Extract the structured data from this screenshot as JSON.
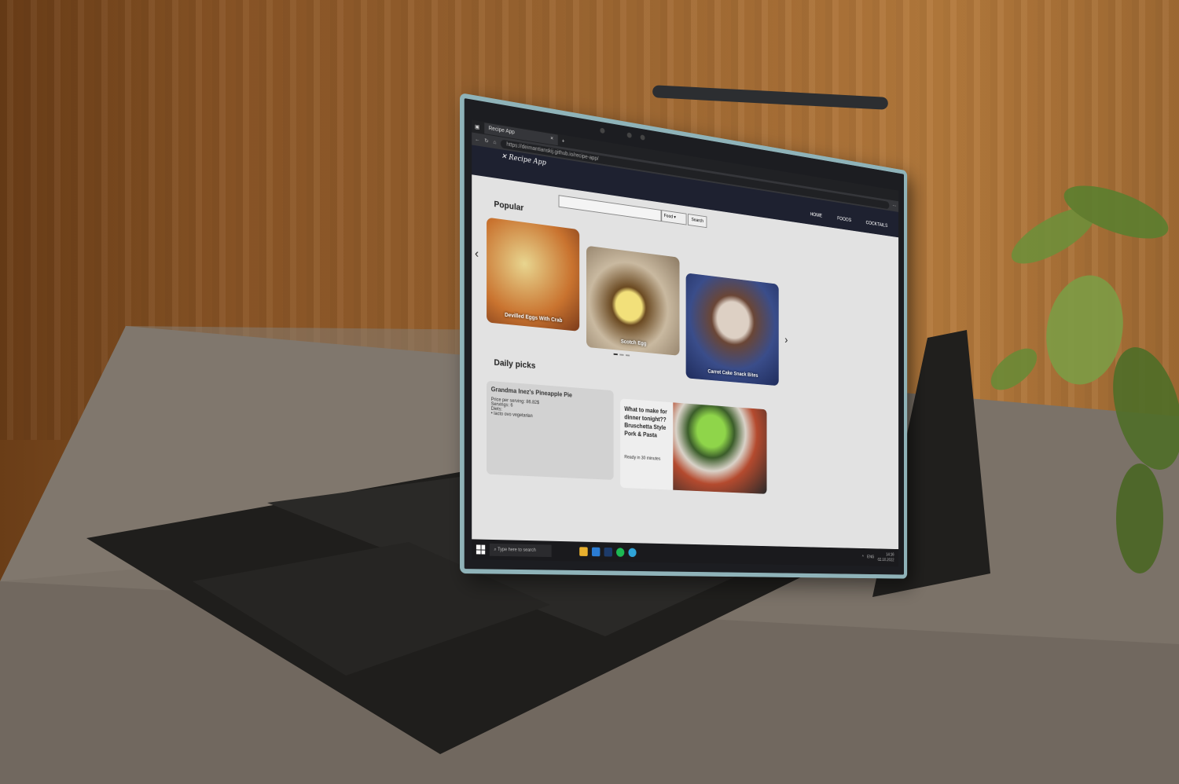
{
  "browser": {
    "tab_title": "Recipe App",
    "close_glyph": "×",
    "new_tab_glyph": "+",
    "url": "https://deimantianskij.github.io/recipe-app/"
  },
  "site": {
    "logo": "Recipe App",
    "nav": [
      "HOME",
      "FOODS",
      "COCKTAILS"
    ],
    "search": {
      "placeholder": "",
      "select_value": "Food",
      "button_label": "Search"
    },
    "popular_heading": "Popular",
    "carousel": [
      {
        "caption": "Devilled Eggs With Crab"
      },
      {
        "caption": "Scotch Egg"
      },
      {
        "caption": "Carrot Cake Snack Bites"
      }
    ],
    "daily_heading": "Daily picks",
    "daily_pick": {
      "title": "Grandma Inez's Pineapple Pie",
      "price": "Price per serving: 86.82$",
      "servings": "Servings: 6",
      "diets": "Diets:",
      "diet_item": "lacto ovo vegetarian"
    },
    "ad": {
      "line1": "What to make for dinner tonight??",
      "line2": "Bruschetta Style Pork & Pasta",
      "ready": "Ready in 30 minutes"
    }
  },
  "taskbar": {
    "search_placeholder": "Type here to search",
    "lang": "ENG",
    "time": "14:16",
    "date": "02.10.2022"
  },
  "colors": {
    "navbar": "#1e2130",
    "page_bg": "#e2e2e2",
    "tablet_frame": "#8fb3b9"
  },
  "icons": [
    "windows-icon",
    "search-icon",
    "arrow-left-icon",
    "arrow-right-icon",
    "refresh-icon",
    "home-icon",
    "lock-icon"
  ]
}
